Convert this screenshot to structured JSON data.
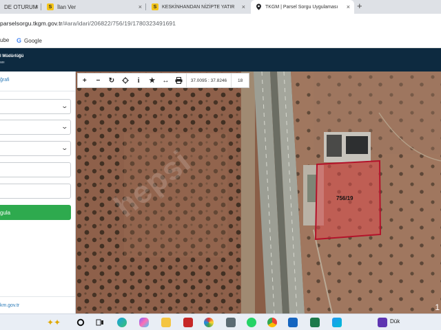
{
  "browser": {
    "tabs": [
      {
        "label": "DE OTURUM",
        "favicon": "s-icon",
        "active": false
      },
      {
        "label": "İlan Ver",
        "favicon": "s-icon",
        "active": false
      },
      {
        "label": "KESKİNHANDAN NİZİPTE YATIR",
        "favicon": "s-icon",
        "active": false
      },
      {
        "label": "TKGM | Parsel Sorgu Uygulaması",
        "favicon": "map-pin-icon",
        "active": true
      }
    ],
    "new_tab": "+",
    "close_glyph": "×",
    "url_host": "parselsorgu.tkgm.gov.tr",
    "url_path": "/#ara/idari/206822/756/19/1780323491691",
    "bookmarks": [
      {
        "label": "ube",
        "icon": "youtube-icon"
      },
      {
        "label": "Google",
        "icon": "google-icon"
      }
    ]
  },
  "site": {
    "header_line1": "l Müdürlüğü",
    "header_line2": "ası"
  },
  "sidebar": {
    "title": "ğrafi",
    "query_button": "gula",
    "footer_link": "km.gov.tr"
  },
  "map": {
    "coordinates": "37.0095 : 37.8246",
    "zoom": "18",
    "parcel_label": "756/19",
    "watermark": "hepsi",
    "corner_text": "1",
    "colors": {
      "parcel_fill": "#d84a4a",
      "parcel_border": "#b3122a",
      "soil": "#8a5e47",
      "road": "#9c9e94"
    }
  },
  "taskbar": {
    "running_label": "Dük"
  }
}
